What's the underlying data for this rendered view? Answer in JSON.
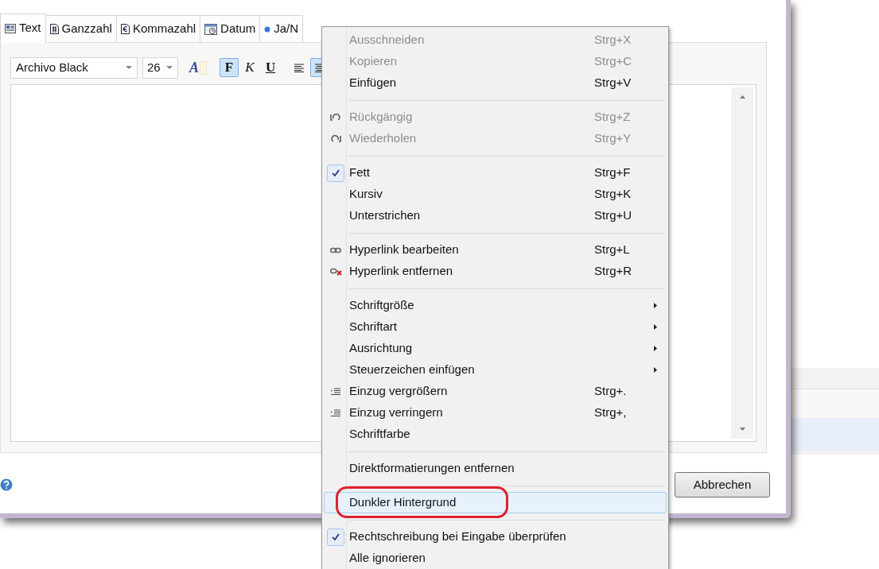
{
  "dialog": {
    "tabs": [
      {
        "label": "Text",
        "kind": "text",
        "selected": true
      },
      {
        "label": "Ganzzahl",
        "kind": "integer",
        "selected": false
      },
      {
        "label": "Kommazahl",
        "kind": "decimal",
        "selected": false
      },
      {
        "label": "Datum",
        "kind": "date",
        "selected": false
      },
      {
        "label": "Ja/N",
        "kind": "boolean",
        "selected": false
      }
    ],
    "toolbar": {
      "font": "Archivo Black",
      "size": "26",
      "font_color_label": "A",
      "format_buttons": [
        {
          "label": "F",
          "kind": "bold",
          "selected": true
        },
        {
          "label": "K",
          "kind": "italic",
          "selected": false
        },
        {
          "label": "U",
          "kind": "underline",
          "selected": false
        }
      ],
      "align_buttons": [
        {
          "kind": "left",
          "selected": false
        },
        {
          "kind": "center",
          "selected": true
        }
      ]
    },
    "cancel_button": "Abbrechen"
  },
  "context_menu": {
    "items": [
      {
        "kind": "item",
        "label": "Ausschneiden",
        "shortcut": "Strg+X",
        "disabled": true,
        "checked": false,
        "submenu": false,
        "selected": false
      },
      {
        "kind": "item",
        "label": "Kopieren",
        "shortcut": "Strg+C",
        "disabled": true,
        "checked": false,
        "submenu": false,
        "selected": false
      },
      {
        "kind": "item",
        "label": "Einfügen",
        "shortcut": "Strg+V",
        "disabled": false,
        "checked": false,
        "submenu": false,
        "selected": false
      },
      {
        "kind": "separator"
      },
      {
        "kind": "undo",
        "label": "Rückgängig",
        "shortcut": "Strg+Z",
        "disabled": true,
        "checked": false,
        "submenu": false,
        "selected": false
      },
      {
        "kind": "redo",
        "label": "Wiederholen",
        "shortcut": "Strg+Y",
        "disabled": true,
        "checked": false,
        "submenu": false,
        "selected": false
      },
      {
        "kind": "separator"
      },
      {
        "kind": "item",
        "label": "Fett",
        "shortcut": "Strg+F",
        "disabled": false,
        "checked": true,
        "submenu": false,
        "selected": false
      },
      {
        "kind": "item",
        "label": "Kursiv",
        "shortcut": "Strg+K",
        "disabled": false,
        "checked": false,
        "submenu": false,
        "selected": false
      },
      {
        "kind": "item",
        "label": "Unterstrichen",
        "shortcut": "Strg+U",
        "disabled": false,
        "checked": false,
        "submenu": false,
        "selected": false
      },
      {
        "kind": "separator"
      },
      {
        "kind": "link",
        "label": "Hyperlink bearbeiten",
        "shortcut": "Strg+L",
        "disabled": false,
        "checked": false,
        "submenu": false,
        "selected": false
      },
      {
        "kind": "unlink",
        "label": "Hyperlink entfernen",
        "shortcut": "Strg+R",
        "disabled": false,
        "checked": false,
        "submenu": false,
        "selected": false
      },
      {
        "kind": "separator"
      },
      {
        "kind": "item",
        "label": "Schriftgröße",
        "disabled": false,
        "checked": false,
        "submenu": true,
        "selected": false
      },
      {
        "kind": "item",
        "label": "Schriftart",
        "disabled": false,
        "checked": false,
        "submenu": true,
        "selected": false
      },
      {
        "kind": "item",
        "label": "Ausrichtung",
        "disabled": false,
        "checked": false,
        "submenu": true,
        "selected": false
      },
      {
        "kind": "item",
        "label": "Steuerzeichen einfügen",
        "disabled": false,
        "checked": false,
        "submenu": true,
        "selected": false
      },
      {
        "kind": "indent",
        "label": "Einzug vergrößern",
        "shortcut": "Strg+.",
        "disabled": false,
        "checked": false,
        "submenu": false,
        "selected": false
      },
      {
        "kind": "indent",
        "label": "Einzug verringern",
        "shortcut": "Strg+,",
        "disabled": false,
        "checked": false,
        "submenu": false,
        "selected": false
      },
      {
        "kind": "item",
        "label": "Schriftfarbe",
        "disabled": false,
        "checked": false,
        "submenu": false,
        "selected": false
      },
      {
        "kind": "separator"
      },
      {
        "kind": "item",
        "label": "Direktformatierungen entfernen",
        "disabled": false,
        "checked": false,
        "submenu": false,
        "selected": false
      },
      {
        "kind": "separator"
      },
      {
        "kind": "item",
        "label": "Dunkler Hintergrund",
        "disabled": false,
        "checked": false,
        "submenu": false,
        "selected": true
      },
      {
        "kind": "separator"
      },
      {
        "kind": "item",
        "label": "Rechtschreibung bei Eingabe überprüfen",
        "disabled": false,
        "checked": true,
        "submenu": false,
        "selected": false
      },
      {
        "kind": "item",
        "label": "Alle ignorieren",
        "disabled": false,
        "checked": false,
        "submenu": false,
        "selected": false
      }
    ]
  }
}
